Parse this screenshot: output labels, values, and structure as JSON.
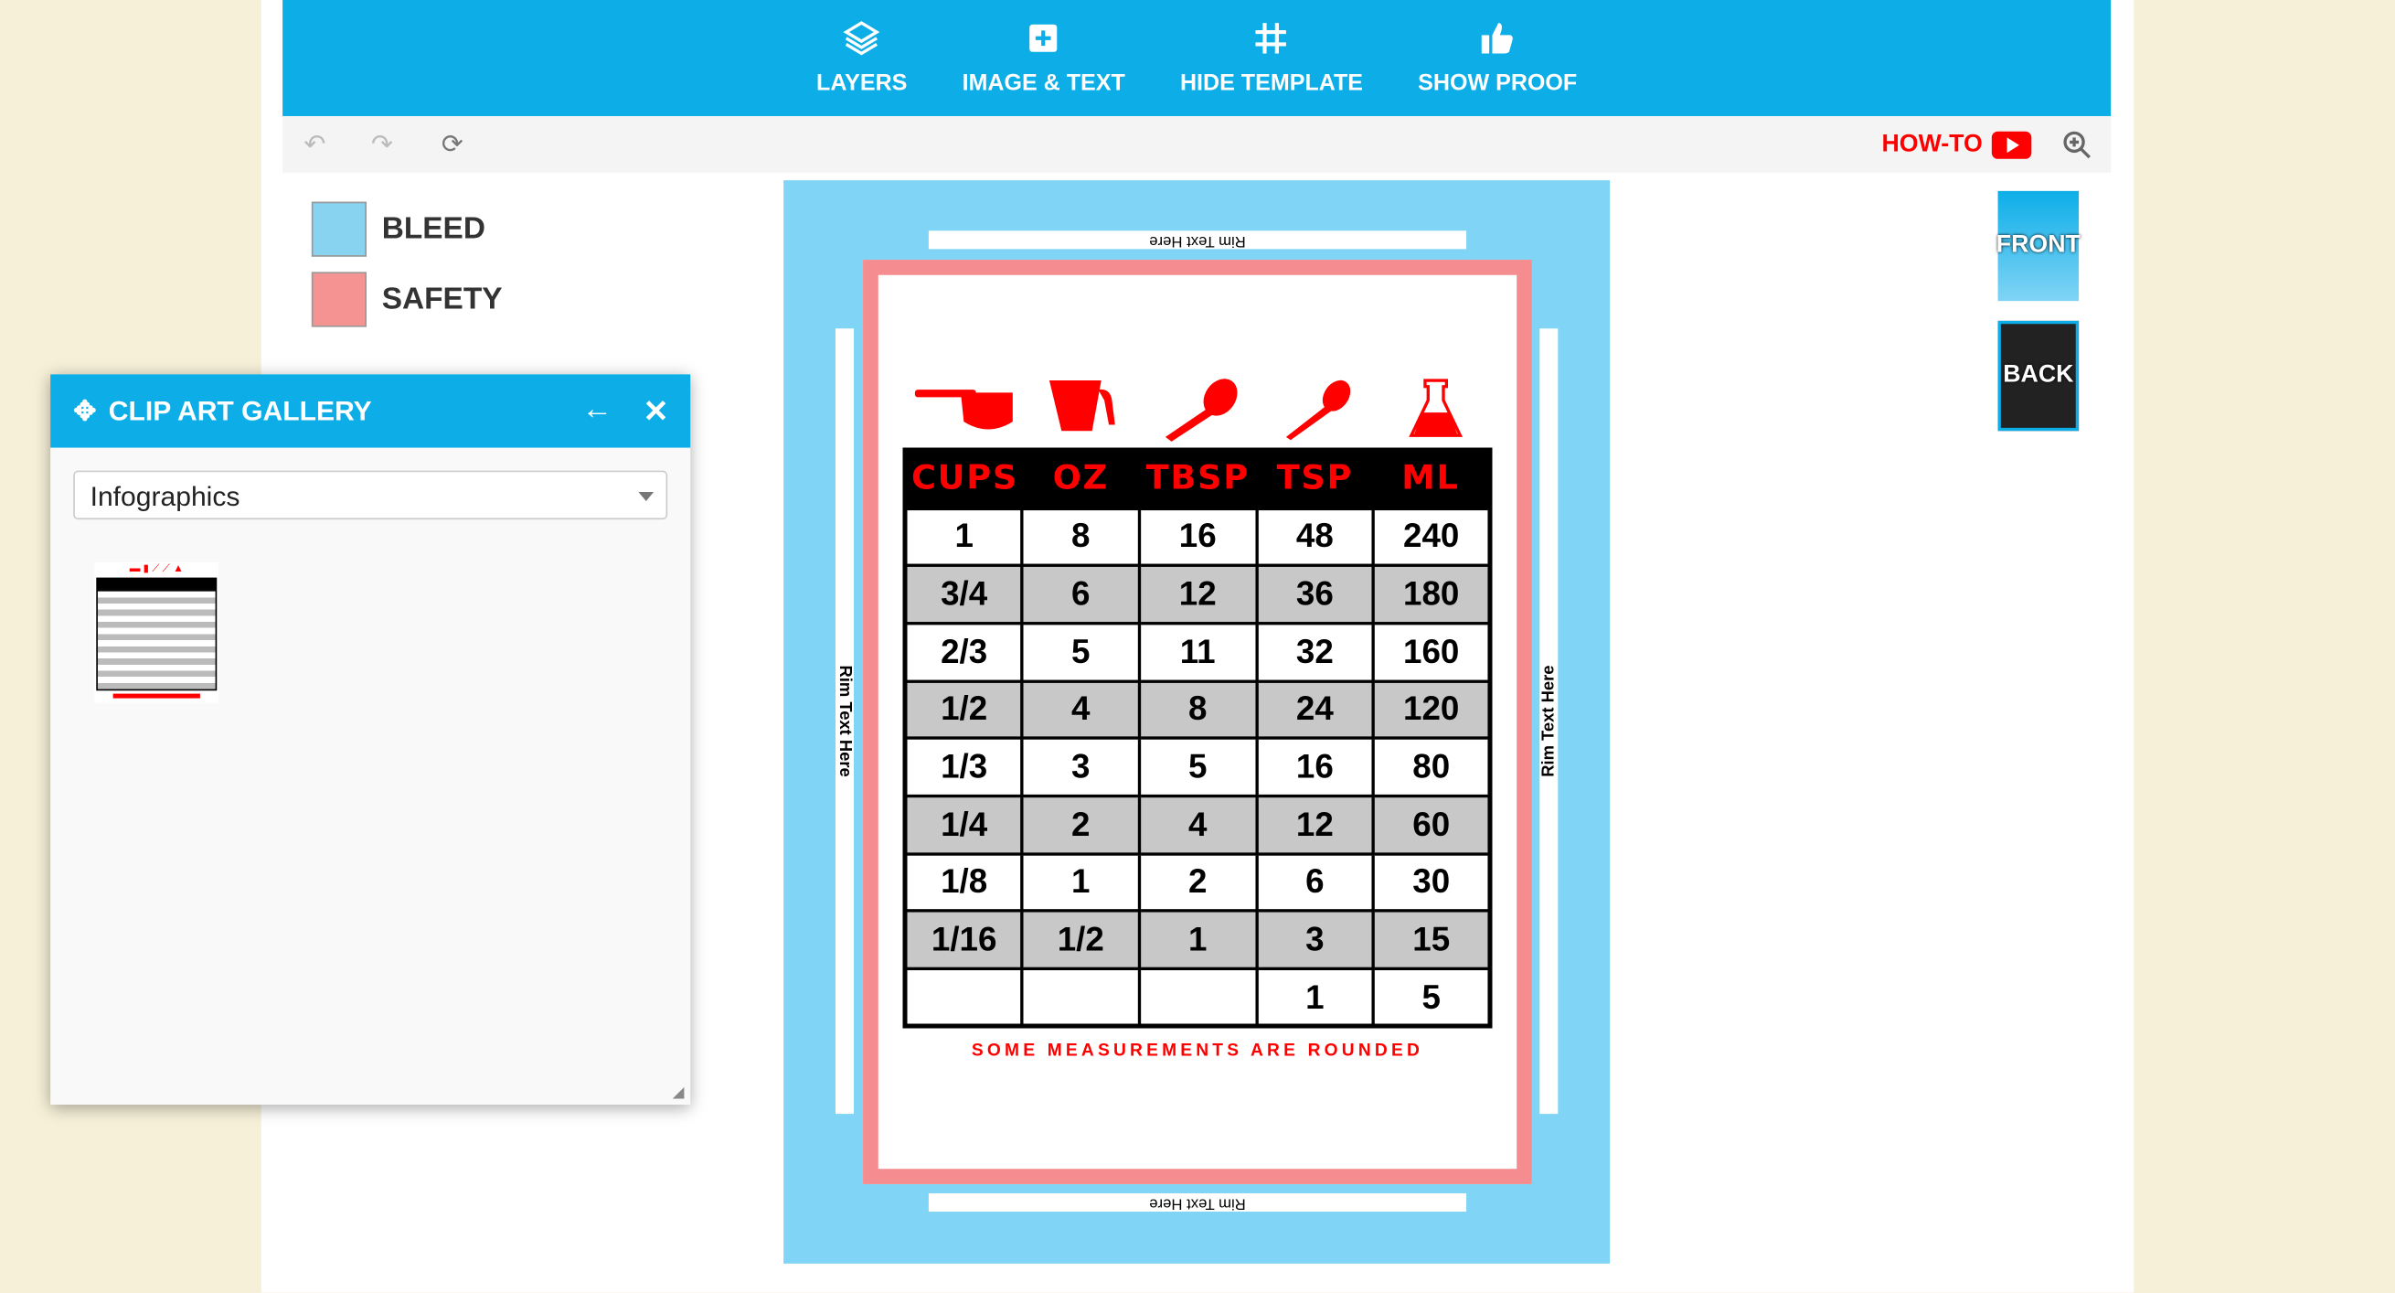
{
  "toolbar": {
    "items": [
      {
        "label": "LAYERS",
        "icon": "layers-icon"
      },
      {
        "label": "IMAGE & TEXT",
        "icon": "plus-square-icon"
      },
      {
        "label": "HIDE TEMPLATE",
        "icon": "grid-icon"
      },
      {
        "label": "SHOW PROOF",
        "icon": "thumbs-up-icon"
      }
    ]
  },
  "subbar": {
    "howto": "HOW-TO"
  },
  "legend": {
    "bleed": "BLEED",
    "safety": "SAFETY",
    "bleed_color": "#80d4f5",
    "safety_color": "#f58c8f"
  },
  "canvas": {
    "rim_text": "Rim Text Here",
    "table": {
      "headers": [
        "CUPS",
        "OZ",
        "TBSP",
        "TSP",
        "ML"
      ],
      "rows": [
        [
          "1",
          "8",
          "16",
          "48",
          "240"
        ],
        [
          "3/4",
          "6",
          "12",
          "36",
          "180"
        ],
        [
          "2/3",
          "5",
          "11",
          "32",
          "160"
        ],
        [
          "1/2",
          "4",
          "8",
          "24",
          "120"
        ],
        [
          "1/3",
          "3",
          "5",
          "16",
          "80"
        ],
        [
          "1/4",
          "2",
          "4",
          "12",
          "60"
        ],
        [
          "1/8",
          "1",
          "2",
          "6",
          "30"
        ],
        [
          "1/16",
          "1/2",
          "1",
          "3",
          "15"
        ],
        [
          "",
          "",
          "",
          "1",
          "5"
        ]
      ]
    },
    "footer": "SOME MEASUREMENTS ARE ROUNDED"
  },
  "sides": {
    "front": "FRONT",
    "back": "BACK"
  },
  "panel": {
    "title": "CLIP ART GALLERY",
    "category": "Infographics"
  },
  "colors": {
    "accent": "#0daee8",
    "red": "#ff0000"
  }
}
